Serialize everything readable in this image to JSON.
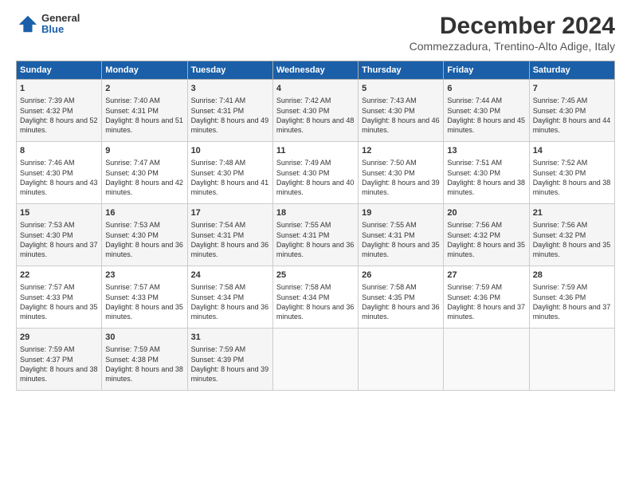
{
  "logo": {
    "general": "General",
    "blue": "Blue"
  },
  "title": "December 2024",
  "subtitle": "Commezzadura, Trentino-Alto Adige, Italy",
  "weekdays": [
    "Sunday",
    "Monday",
    "Tuesday",
    "Wednesday",
    "Thursday",
    "Friday",
    "Saturday"
  ],
  "weeks": [
    [
      {
        "day": 1,
        "sunrise": "7:39 AM",
        "sunset": "4:32 PM",
        "daylight": "8 hours and 52 minutes."
      },
      {
        "day": 2,
        "sunrise": "7:40 AM",
        "sunset": "4:31 PM",
        "daylight": "8 hours and 51 minutes."
      },
      {
        "day": 3,
        "sunrise": "7:41 AM",
        "sunset": "4:31 PM",
        "daylight": "8 hours and 49 minutes."
      },
      {
        "day": 4,
        "sunrise": "7:42 AM",
        "sunset": "4:30 PM",
        "daylight": "8 hours and 48 minutes."
      },
      {
        "day": 5,
        "sunrise": "7:43 AM",
        "sunset": "4:30 PM",
        "daylight": "8 hours and 46 minutes."
      },
      {
        "day": 6,
        "sunrise": "7:44 AM",
        "sunset": "4:30 PM",
        "daylight": "8 hours and 45 minutes."
      },
      {
        "day": 7,
        "sunrise": "7:45 AM",
        "sunset": "4:30 PM",
        "daylight": "8 hours and 44 minutes."
      }
    ],
    [
      {
        "day": 8,
        "sunrise": "7:46 AM",
        "sunset": "4:30 PM",
        "daylight": "8 hours and 43 minutes."
      },
      {
        "day": 9,
        "sunrise": "7:47 AM",
        "sunset": "4:30 PM",
        "daylight": "8 hours and 42 minutes."
      },
      {
        "day": 10,
        "sunrise": "7:48 AM",
        "sunset": "4:30 PM",
        "daylight": "8 hours and 41 minutes."
      },
      {
        "day": 11,
        "sunrise": "7:49 AM",
        "sunset": "4:30 PM",
        "daylight": "8 hours and 40 minutes."
      },
      {
        "day": 12,
        "sunrise": "7:50 AM",
        "sunset": "4:30 PM",
        "daylight": "8 hours and 39 minutes."
      },
      {
        "day": 13,
        "sunrise": "7:51 AM",
        "sunset": "4:30 PM",
        "daylight": "8 hours and 38 minutes."
      },
      {
        "day": 14,
        "sunrise": "7:52 AM",
        "sunset": "4:30 PM",
        "daylight": "8 hours and 38 minutes."
      }
    ],
    [
      {
        "day": 15,
        "sunrise": "7:53 AM",
        "sunset": "4:30 PM",
        "daylight": "8 hours and 37 minutes."
      },
      {
        "day": 16,
        "sunrise": "7:53 AM",
        "sunset": "4:30 PM",
        "daylight": "8 hours and 36 minutes."
      },
      {
        "day": 17,
        "sunrise": "7:54 AM",
        "sunset": "4:31 PM",
        "daylight": "8 hours and 36 minutes."
      },
      {
        "day": 18,
        "sunrise": "7:55 AM",
        "sunset": "4:31 PM",
        "daylight": "8 hours and 36 minutes."
      },
      {
        "day": 19,
        "sunrise": "7:55 AM",
        "sunset": "4:31 PM",
        "daylight": "8 hours and 35 minutes."
      },
      {
        "day": 20,
        "sunrise": "7:56 AM",
        "sunset": "4:32 PM",
        "daylight": "8 hours and 35 minutes."
      },
      {
        "day": 21,
        "sunrise": "7:56 AM",
        "sunset": "4:32 PM",
        "daylight": "8 hours and 35 minutes."
      }
    ],
    [
      {
        "day": 22,
        "sunrise": "7:57 AM",
        "sunset": "4:33 PM",
        "daylight": "8 hours and 35 minutes."
      },
      {
        "day": 23,
        "sunrise": "7:57 AM",
        "sunset": "4:33 PM",
        "daylight": "8 hours and 35 minutes."
      },
      {
        "day": 24,
        "sunrise": "7:58 AM",
        "sunset": "4:34 PM",
        "daylight": "8 hours and 36 minutes."
      },
      {
        "day": 25,
        "sunrise": "7:58 AM",
        "sunset": "4:34 PM",
        "daylight": "8 hours and 36 minutes."
      },
      {
        "day": 26,
        "sunrise": "7:58 AM",
        "sunset": "4:35 PM",
        "daylight": "8 hours and 36 minutes."
      },
      {
        "day": 27,
        "sunrise": "7:59 AM",
        "sunset": "4:36 PM",
        "daylight": "8 hours and 37 minutes."
      },
      {
        "day": 28,
        "sunrise": "7:59 AM",
        "sunset": "4:36 PM",
        "daylight": "8 hours and 37 minutes."
      }
    ],
    [
      {
        "day": 29,
        "sunrise": "7:59 AM",
        "sunset": "4:37 PM",
        "daylight": "8 hours and 38 minutes."
      },
      {
        "day": 30,
        "sunrise": "7:59 AM",
        "sunset": "4:38 PM",
        "daylight": "8 hours and 38 minutes."
      },
      {
        "day": 31,
        "sunrise": "7:59 AM",
        "sunset": "4:39 PM",
        "daylight": "8 hours and 39 minutes."
      },
      null,
      null,
      null,
      null
    ]
  ]
}
